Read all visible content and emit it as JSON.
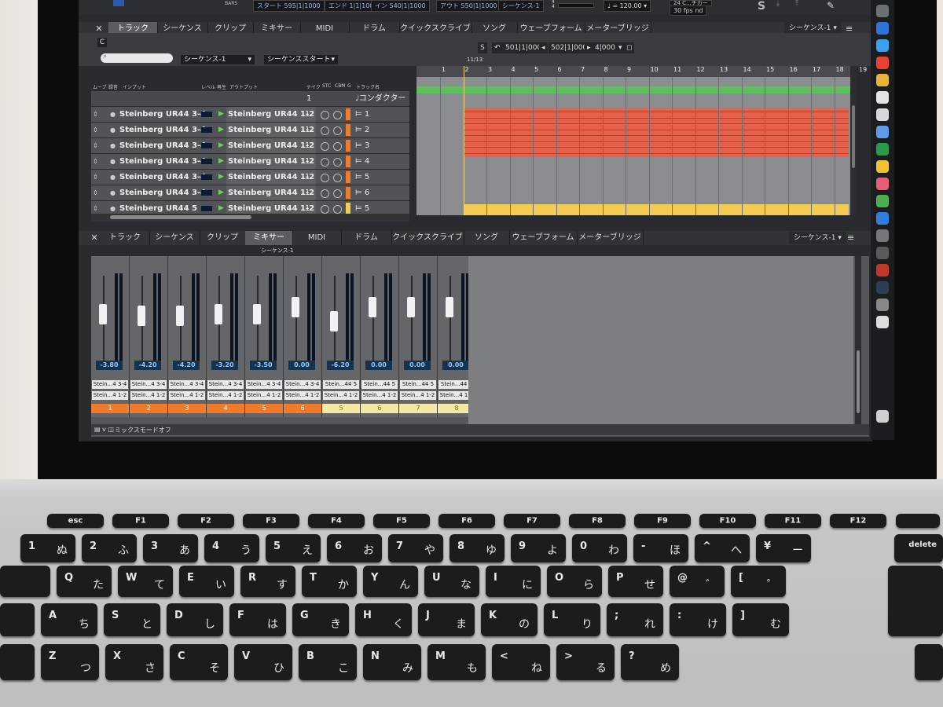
{
  "daw": {
    "top": {
      "start": "スタート 595|1|1000",
      "end": "エンド 1|1|1000",
      "in": "イン 540|1|1000",
      "out": "アウト 550|1|1000",
      "sequence": "シーケンス-1",
      "tempo": "120.00",
      "timesig_num": "4",
      "timesig_den": "4",
      "sr": "24 C...チカー",
      "fps": "30 fps nd",
      "bars": "BARS"
    },
    "editor": {
      "tabs": [
        "トラック",
        "シーケンス",
        "クリップ",
        "ミキサー",
        "MIDI",
        "ドラム",
        "クイックスクライブ",
        "ソング",
        "ウェーブフォーム",
        "メーターブリッジ"
      ],
      "active_tab": 0,
      "seq_select": "シーケンス-1 ▾",
      "c_label": "C",
      "seq_dropdown": "シーケンス-1",
      "start_dropdown": "シーケンススタート",
      "s_label": "S",
      "pos1": "501|1|000",
      "pos2": "502|1|000",
      "pos3": "4|000",
      "ratio": "11/13",
      "ruler": [
        "1",
        "2",
        "3",
        "4",
        "5",
        "6",
        "7",
        "8",
        "9",
        "10",
        "11",
        "12",
        "13",
        "14",
        "15",
        "16",
        "17",
        "18",
        "19"
      ],
      "headers": {
        "mute": "ムーブ",
        "rec": "録音",
        "input": "インプット",
        "level": "レベル",
        "play": "再生",
        "output": "アウトプット",
        "take": "テイク",
        "stc": "STC",
        "cbm": "CBM",
        "g": "G",
        "name": "トラック名"
      },
      "conductor_take": "1",
      "conductor": "コンダクター",
      "tracks": [
        {
          "input": "Steinberg UR44 3-4",
          "output": "Steinberg UR44 1-2",
          "take": "1",
          "name": "1",
          "color": "#f07b2a"
        },
        {
          "input": "Steinberg UR44 3-4",
          "output": "Steinberg UR44 1-2",
          "take": "1",
          "name": "2",
          "color": "#f07b2a"
        },
        {
          "input": "Steinberg UR44 3-4",
          "output": "Steinberg UR44 1-2",
          "take": "1",
          "name": "3",
          "color": "#f07b2a"
        },
        {
          "input": "Steinberg UR44 3-4",
          "output": "Steinberg UR44 1-2",
          "take": "1",
          "name": "4",
          "color": "#f07b2a"
        },
        {
          "input": "Steinberg UR44 3-4",
          "output": "Steinberg UR44 1-2",
          "take": "1",
          "name": "5",
          "color": "#f07b2a"
        },
        {
          "input": "Steinberg UR44 3-4",
          "output": "Steinberg UR44 1-2",
          "take": "1",
          "name": "6",
          "color": "#f07b2a"
        },
        {
          "input": "Steinberg UR44 5",
          "output": "Steinberg UR44 1-2",
          "take": "1",
          "name": "5",
          "color": "#f3cc54"
        }
      ]
    },
    "mixer": {
      "tabs": [
        "トラック",
        "シーケンス",
        "クリップ",
        "ミキサー",
        "MIDI",
        "ドラム",
        "クイックスクライブ",
        "ソング",
        "ウェーブフォーム",
        "メーターブリッジ"
      ],
      "active_tab": 3,
      "seq_select": "シーケンス-1 ▾",
      "seq_title": "シーケンス-1",
      "footer": "ミックスモードオフ",
      "strips": [
        {
          "val": "-3.80",
          "io1": "Stein...4 3-4",
          "io2": "Stein...4 1-2",
          "num": "1",
          "color": "#f07b2a",
          "fader": 0.6
        },
        {
          "val": "-4.20",
          "io1": "Stein...4 3-4",
          "io2": "Stein...4 1-2",
          "num": "2",
          "color": "#f07b2a",
          "fader": 0.58
        },
        {
          "val": "-4.20",
          "io1": "Stein...4 3-4",
          "io2": "Stein...4 1-2",
          "num": "3",
          "color": "#f07b2a",
          "fader": 0.58
        },
        {
          "val": "-3.20",
          "io1": "Stein...4 3-4",
          "io2": "Stein...4 1-2",
          "num": "4",
          "color": "#f07b2a",
          "fader": 0.6
        },
        {
          "val": "-3.50",
          "io1": "Stein...4 3-4",
          "io2": "Stein...4 1-2",
          "num": "5",
          "color": "#f07b2a",
          "fader": 0.6
        },
        {
          "val": "0.00",
          "io1": "Stein...4 3-4",
          "io2": "Stein...4 1-2",
          "num": "6",
          "color": "#f07b2a",
          "fader": 0.7
        },
        {
          "val": "-6.20",
          "io1": "Stein...44 5",
          "io2": "Stein...4 1-2",
          "num": "5",
          "color": "#f3e9a4",
          "fader": 0.5
        },
        {
          "val": "0.00",
          "io1": "Stein...44 5",
          "io2": "Stein...4 1-2",
          "num": "6",
          "color": "#f3e9a4",
          "fader": 0.7
        },
        {
          "val": "0.00",
          "io1": "Stein...44 5",
          "io2": "Stein...4 1-2",
          "num": "7",
          "color": "#f3e9a4",
          "fader": 0.7
        },
        {
          "val": "0.00",
          "io1": "Stein...44 1",
          "io2": "Stein...4 1-2",
          "num": "8",
          "color": "#f3e9a4",
          "fader": 0.7
        }
      ]
    }
  },
  "keyboard": {
    "fn_row": [
      "esc",
      "F1",
      "F2",
      "F3",
      "F4",
      "F5",
      "F6",
      "F7",
      "F8",
      "F9",
      "F10",
      "F11",
      "F12"
    ],
    "row1": [
      [
        "1",
        "ぬ"
      ],
      [
        "2",
        "ふ"
      ],
      [
        "3",
        "あ"
      ],
      [
        "4",
        "う"
      ],
      [
        "5",
        "え"
      ],
      [
        "6",
        "お"
      ],
      [
        "7",
        "や"
      ],
      [
        "8",
        "ゆ"
      ],
      [
        "9",
        "よ"
      ],
      [
        "0",
        "わ"
      ],
      [
        "-",
        "ほ"
      ],
      [
        "^",
        "へ"
      ],
      [
        "¥",
        "ー"
      ]
    ],
    "row2": [
      [
        "Q",
        "た"
      ],
      [
        "W",
        "て"
      ],
      [
        "E",
        "い"
      ],
      [
        "R",
        "す"
      ],
      [
        "T",
        "か"
      ],
      [
        "Y",
        "ん"
      ],
      [
        "U",
        "な"
      ],
      [
        "I",
        "に"
      ],
      [
        "O",
        "ら"
      ],
      [
        "P",
        "せ"
      ],
      [
        "@",
        "゛"
      ],
      [
        "[",
        "゜"
      ]
    ],
    "row3": [
      [
        "A",
        "ち"
      ],
      [
        "S",
        "と"
      ],
      [
        "D",
        "し"
      ],
      [
        "F",
        "は"
      ],
      [
        "G",
        "き"
      ],
      [
        "H",
        "く"
      ],
      [
        "J",
        "ま"
      ],
      [
        "K",
        "の"
      ],
      [
        "L",
        "り"
      ],
      [
        ";",
        "れ"
      ],
      [
        ":",
        "け"
      ],
      [
        "]",
        "む"
      ]
    ],
    "row4": [
      [
        "Z",
        "つ"
      ],
      [
        "X",
        "さ"
      ],
      [
        "C",
        "そ"
      ],
      [
        "V",
        "ひ"
      ],
      [
        "B",
        "こ"
      ],
      [
        "N",
        "み"
      ],
      [
        "M",
        "も"
      ],
      [
        "<",
        "ね"
      ],
      [
        ">",
        "る"
      ],
      [
        "?",
        "め"
      ]
    ],
    "delete": "delete"
  }
}
